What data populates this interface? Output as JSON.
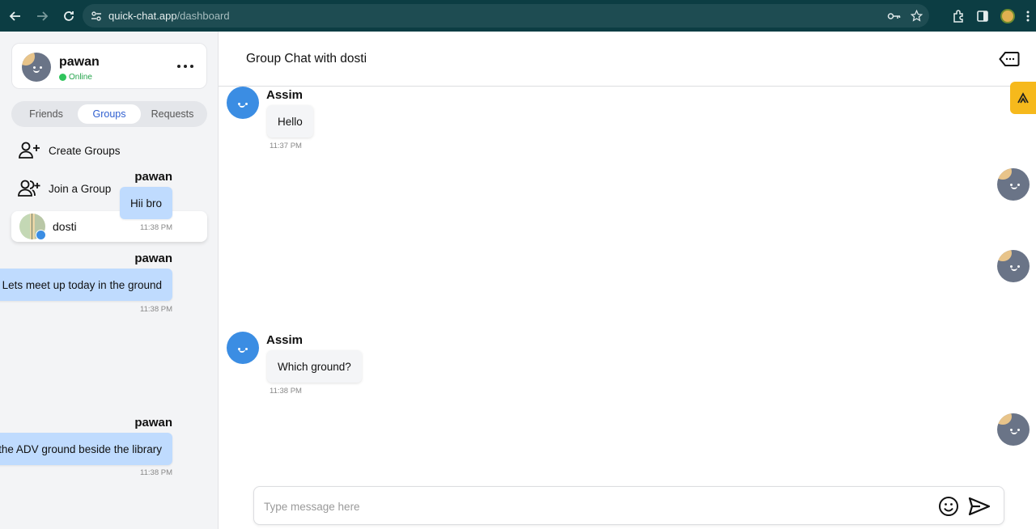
{
  "browser": {
    "url_host": "quick-chat.app",
    "url_path": "/dashboard"
  },
  "sidebar": {
    "user": {
      "name": "pawan",
      "status": "Online"
    },
    "tabs": [
      {
        "label": "Friends",
        "active": false
      },
      {
        "label": "Groups",
        "active": true
      },
      {
        "label": "Requests",
        "active": false
      }
    ],
    "actions": [
      {
        "label": "Create Groups",
        "icon": "add-user-icon"
      },
      {
        "label": "Join a Group",
        "icon": "add-users-icon"
      }
    ],
    "groups": [
      {
        "name": "dosti"
      }
    ]
  },
  "chat": {
    "title": "Group Chat with dosti",
    "messages": [
      {
        "sender": "Assim",
        "text": "Hello",
        "time": "11:37 PM",
        "direction": "in"
      },
      {
        "sender": "pawan",
        "text": "Hii bro",
        "time": "11:38 PM",
        "direction": "out"
      },
      {
        "sender": "pawan",
        "text": "Lets meet up today in the ground",
        "time": "11:38 PM",
        "direction": "out"
      },
      {
        "sender": "Assim",
        "text": "Which ground?",
        "time": "11:38 PM",
        "direction": "in"
      },
      {
        "sender": "pawan",
        "text": "In the ADV ground beside the library",
        "time": "11:38 PM",
        "direction": "out"
      }
    ],
    "composer": {
      "placeholder": "Type message here",
      "value": ""
    }
  },
  "colors": {
    "accent": "#2f5fd0",
    "outgoing_bubble": "#bfdbfe",
    "online": "#2fc45c",
    "browser_bar": "#0c3d43"
  }
}
